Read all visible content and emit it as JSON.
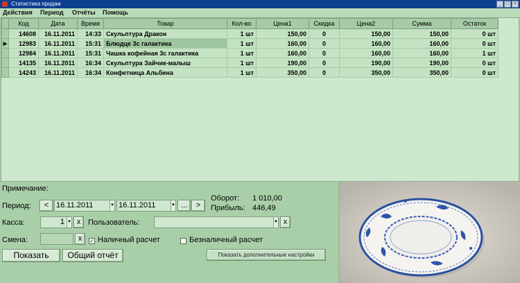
{
  "window": {
    "title": "Статистика продаж",
    "controls": [
      "_",
      "□",
      "×"
    ]
  },
  "menu": [
    "Действия",
    "Период",
    "Отчёты",
    "Помощь"
  ],
  "table": {
    "columns": [
      "Код",
      "Дата",
      "Время",
      "Товар",
      "Кол-во",
      "Цена1",
      "Скидка",
      "Цена2",
      "Сумма",
      "Остаток"
    ],
    "rows": [
      [
        "14608",
        "16.11.2011",
        "14:33",
        "Скульптура Дракон",
        "1 шт",
        "150,00",
        "0",
        "150,00",
        "150,00",
        "0 шт"
      ],
      [
        "12983",
        "16.11.2011",
        "15:31",
        "Блюдце 3с галактика",
        "1 шт",
        "160,00",
        "0",
        "160,00",
        "160,00",
        "0 шт"
      ],
      [
        "12984",
        "16.11.2011",
        "15:31",
        "Чашка кофейная 3с галактика",
        "1 шт",
        "160,00",
        "0",
        "160,00",
        "160,00",
        "1 шт"
      ],
      [
        "14135",
        "16.11.2011",
        "16:34",
        "Скульптура Зайчик-малыш",
        "1 шт",
        "190,00",
        "0",
        "190,00",
        "190,00",
        "0 шт"
      ],
      [
        "14243",
        "16.11.2011",
        "16:34",
        "Конфетница Альбина",
        "1 шт",
        "350,00",
        "0",
        "350,00",
        "350,00",
        "0 шт"
      ]
    ]
  },
  "form": {
    "note_label": "Примечание:",
    "period_label": "Период:",
    "date_from": "16.11.2011",
    "date_to": "16.11.2011",
    "prev_btn": "<",
    "next_btn": ">",
    "dots_btn": "...",
    "turnover_label": "Оборот:",
    "turnover_value": "1 010,00",
    "profit_label": "Прибыль:",
    "profit_value": "446,49",
    "kassa_label": "Касса:",
    "kassa_value": "1",
    "clear_btn": "x",
    "user_label": "Пользователь:",
    "user_value": "",
    "shift_label": "Смена:",
    "shift_value": "",
    "cash_label": "Наличный расчет",
    "cash_checked": true,
    "cashless_label": "Безналичный расчет",
    "cashless_checked": false,
    "show_btn": "Показать",
    "report_btn": "Общий отчёт",
    "more_settings_btn": "Показать дополнительные настройки"
  }
}
